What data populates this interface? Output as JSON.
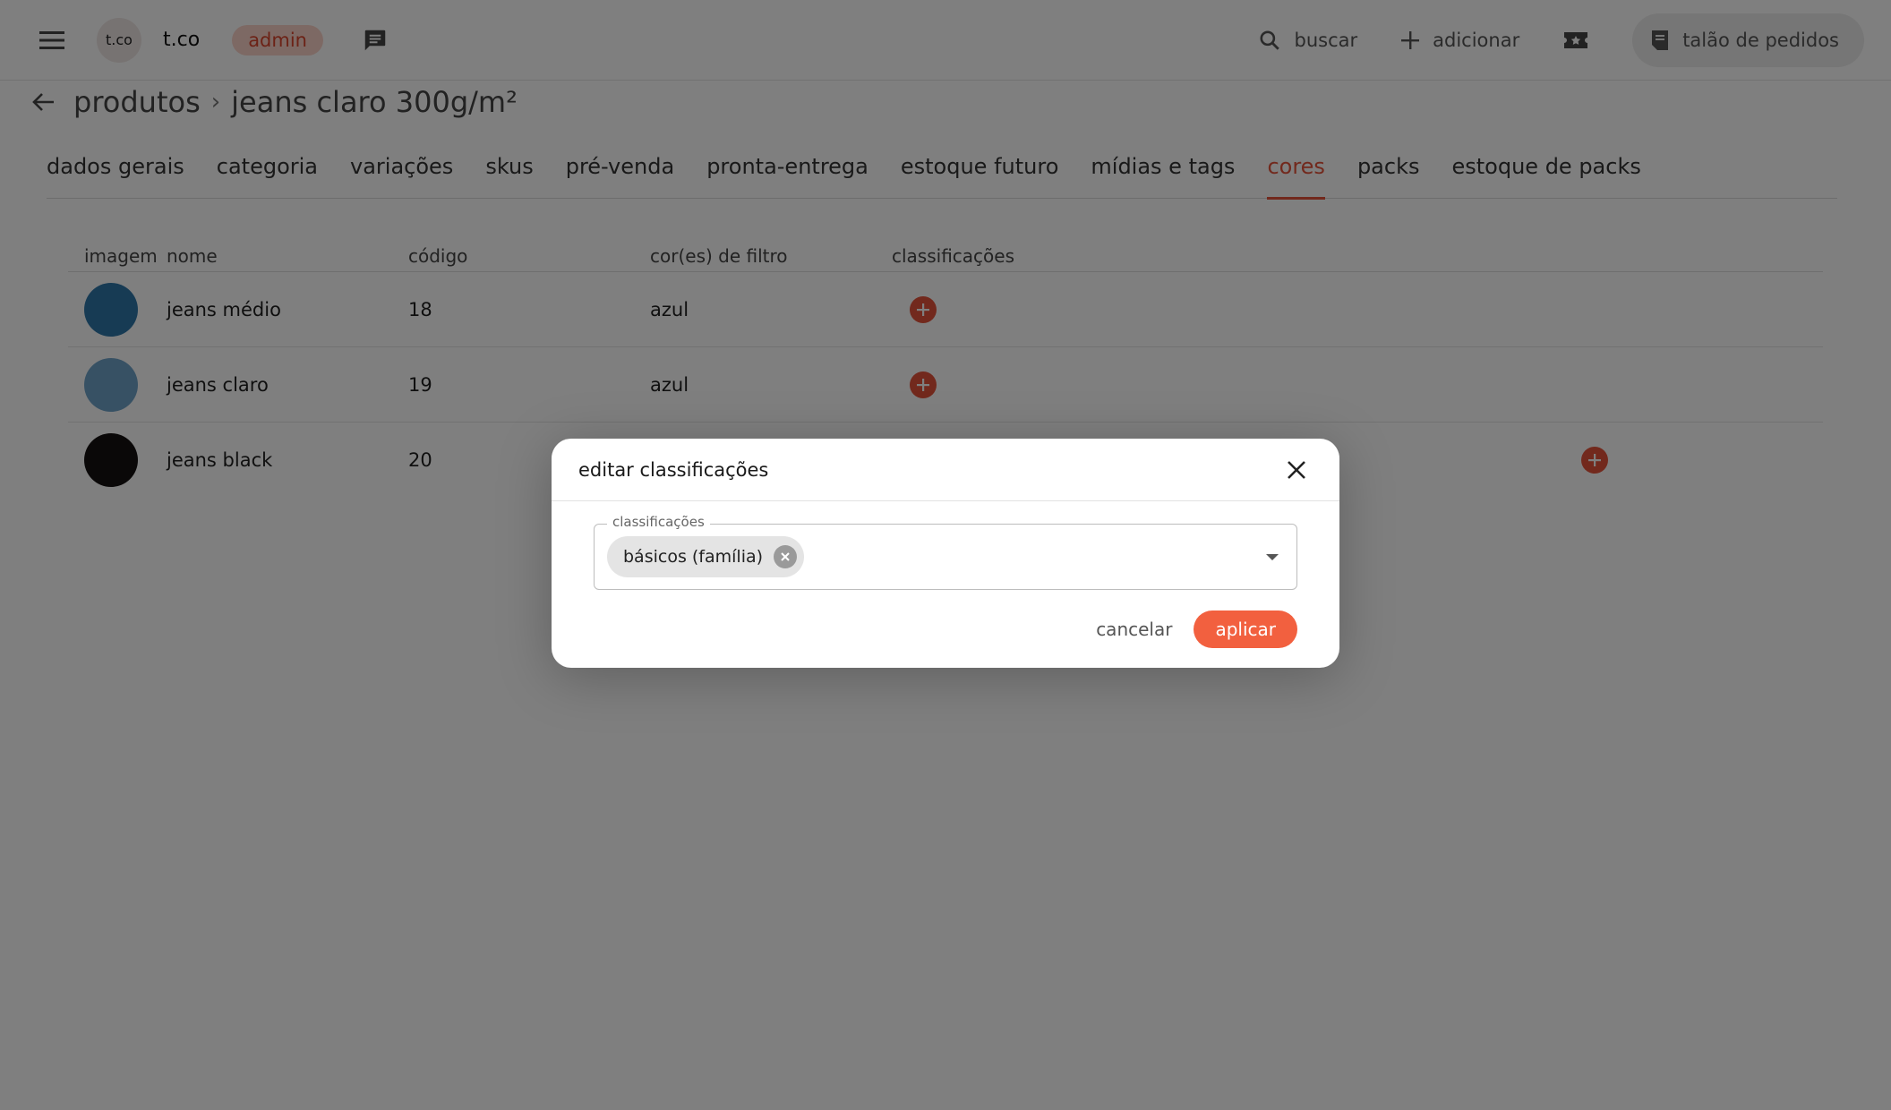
{
  "header": {
    "avatar_text": "t.co",
    "brand": "t.co",
    "role_badge": "admin",
    "search_label": "buscar",
    "add_label": "adicionar",
    "orders_label": "talão de pedidos"
  },
  "breadcrumb": {
    "parent": "produtos",
    "separator": "›",
    "current": "jeans claro 300g/m²"
  },
  "tabs": [
    {
      "label": "dados gerais",
      "active": false
    },
    {
      "label": "categoria",
      "active": false
    },
    {
      "label": "variações",
      "active": false
    },
    {
      "label": "skus",
      "active": false
    },
    {
      "label": "pré-venda",
      "active": false
    },
    {
      "label": "pronta-entrega",
      "active": false
    },
    {
      "label": "estoque futuro",
      "active": false
    },
    {
      "label": "mídias e tags",
      "active": false
    },
    {
      "label": "cores",
      "active": true
    },
    {
      "label": "packs",
      "active": false
    },
    {
      "label": "estoque de packs",
      "active": false
    }
  ],
  "table": {
    "columns": [
      "imagem",
      "nome",
      "código",
      "cor(es) de filtro",
      "classificações"
    ],
    "rows": [
      {
        "color": "#2f76a8",
        "nome": "jeans médio",
        "codigo": "18",
        "cor_filtro": "azul"
      },
      {
        "color": "#6fa3c9",
        "nome": "jeans claro",
        "codigo": "19",
        "cor_filtro": "azul"
      },
      {
        "color": "#141010",
        "nome": "jeans black",
        "codigo": "20",
        "cor_filtro": ""
      }
    ]
  },
  "modal": {
    "title": "editar classificações",
    "field_label": "classificações",
    "chips": [
      "básicos (família)"
    ],
    "cancel_label": "cancelar",
    "apply_label": "aplicar"
  },
  "colors": {
    "accent": "#e5533a",
    "apply_button": "#f2603f",
    "badge_bg": "#fbd3c8"
  }
}
